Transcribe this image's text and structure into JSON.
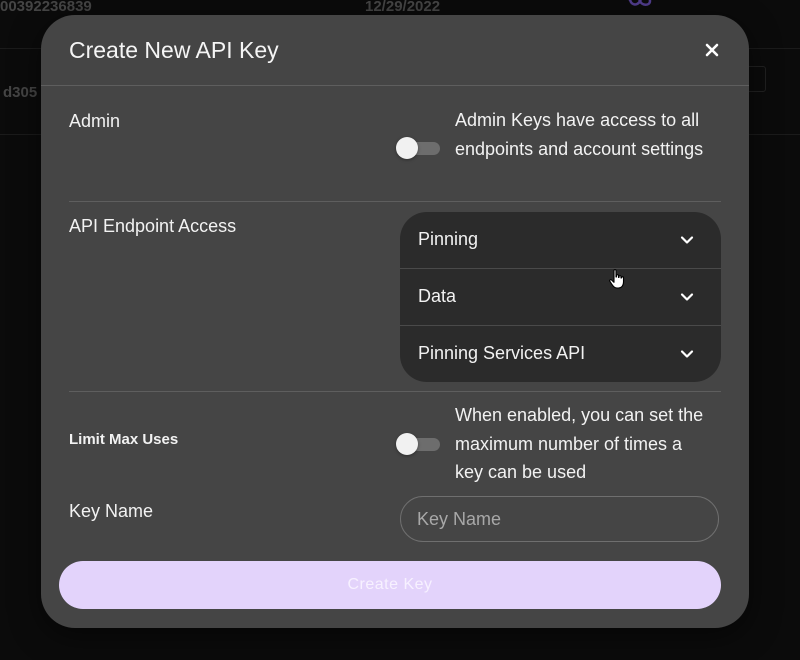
{
  "background": {
    "row1_id": "00392236839",
    "row1_date": "12/29/2022",
    "row2_id": "d305"
  },
  "modal": {
    "title": "Create New API Key",
    "admin": {
      "label": "Admin",
      "description": "Admin Keys have access to all endpoints and account settings",
      "enabled": false
    },
    "endpoint_access": {
      "label": "API Endpoint Access",
      "items": [
        {
          "label": "Pinning"
        },
        {
          "label": "Data"
        },
        {
          "label": "Pinning Services API"
        }
      ]
    },
    "limit_max_uses": {
      "label": "Limit Max Uses",
      "description": "When enabled, you can set the maximum number of times a key can be used",
      "enabled": false
    },
    "key_name": {
      "label": "Key Name",
      "placeholder": "Key Name",
      "value": ""
    },
    "create_button_label": "Create Key"
  },
  "colors": {
    "modal_bg": "#454545",
    "accordion_bg": "#2b2b2b",
    "primary_button": "#e3d3fb",
    "accent_icon": "#7b5cd6"
  },
  "icons": {
    "close": "close-icon",
    "chevron": "chevron-down-icon",
    "cursor": "hand-pointer-icon"
  }
}
